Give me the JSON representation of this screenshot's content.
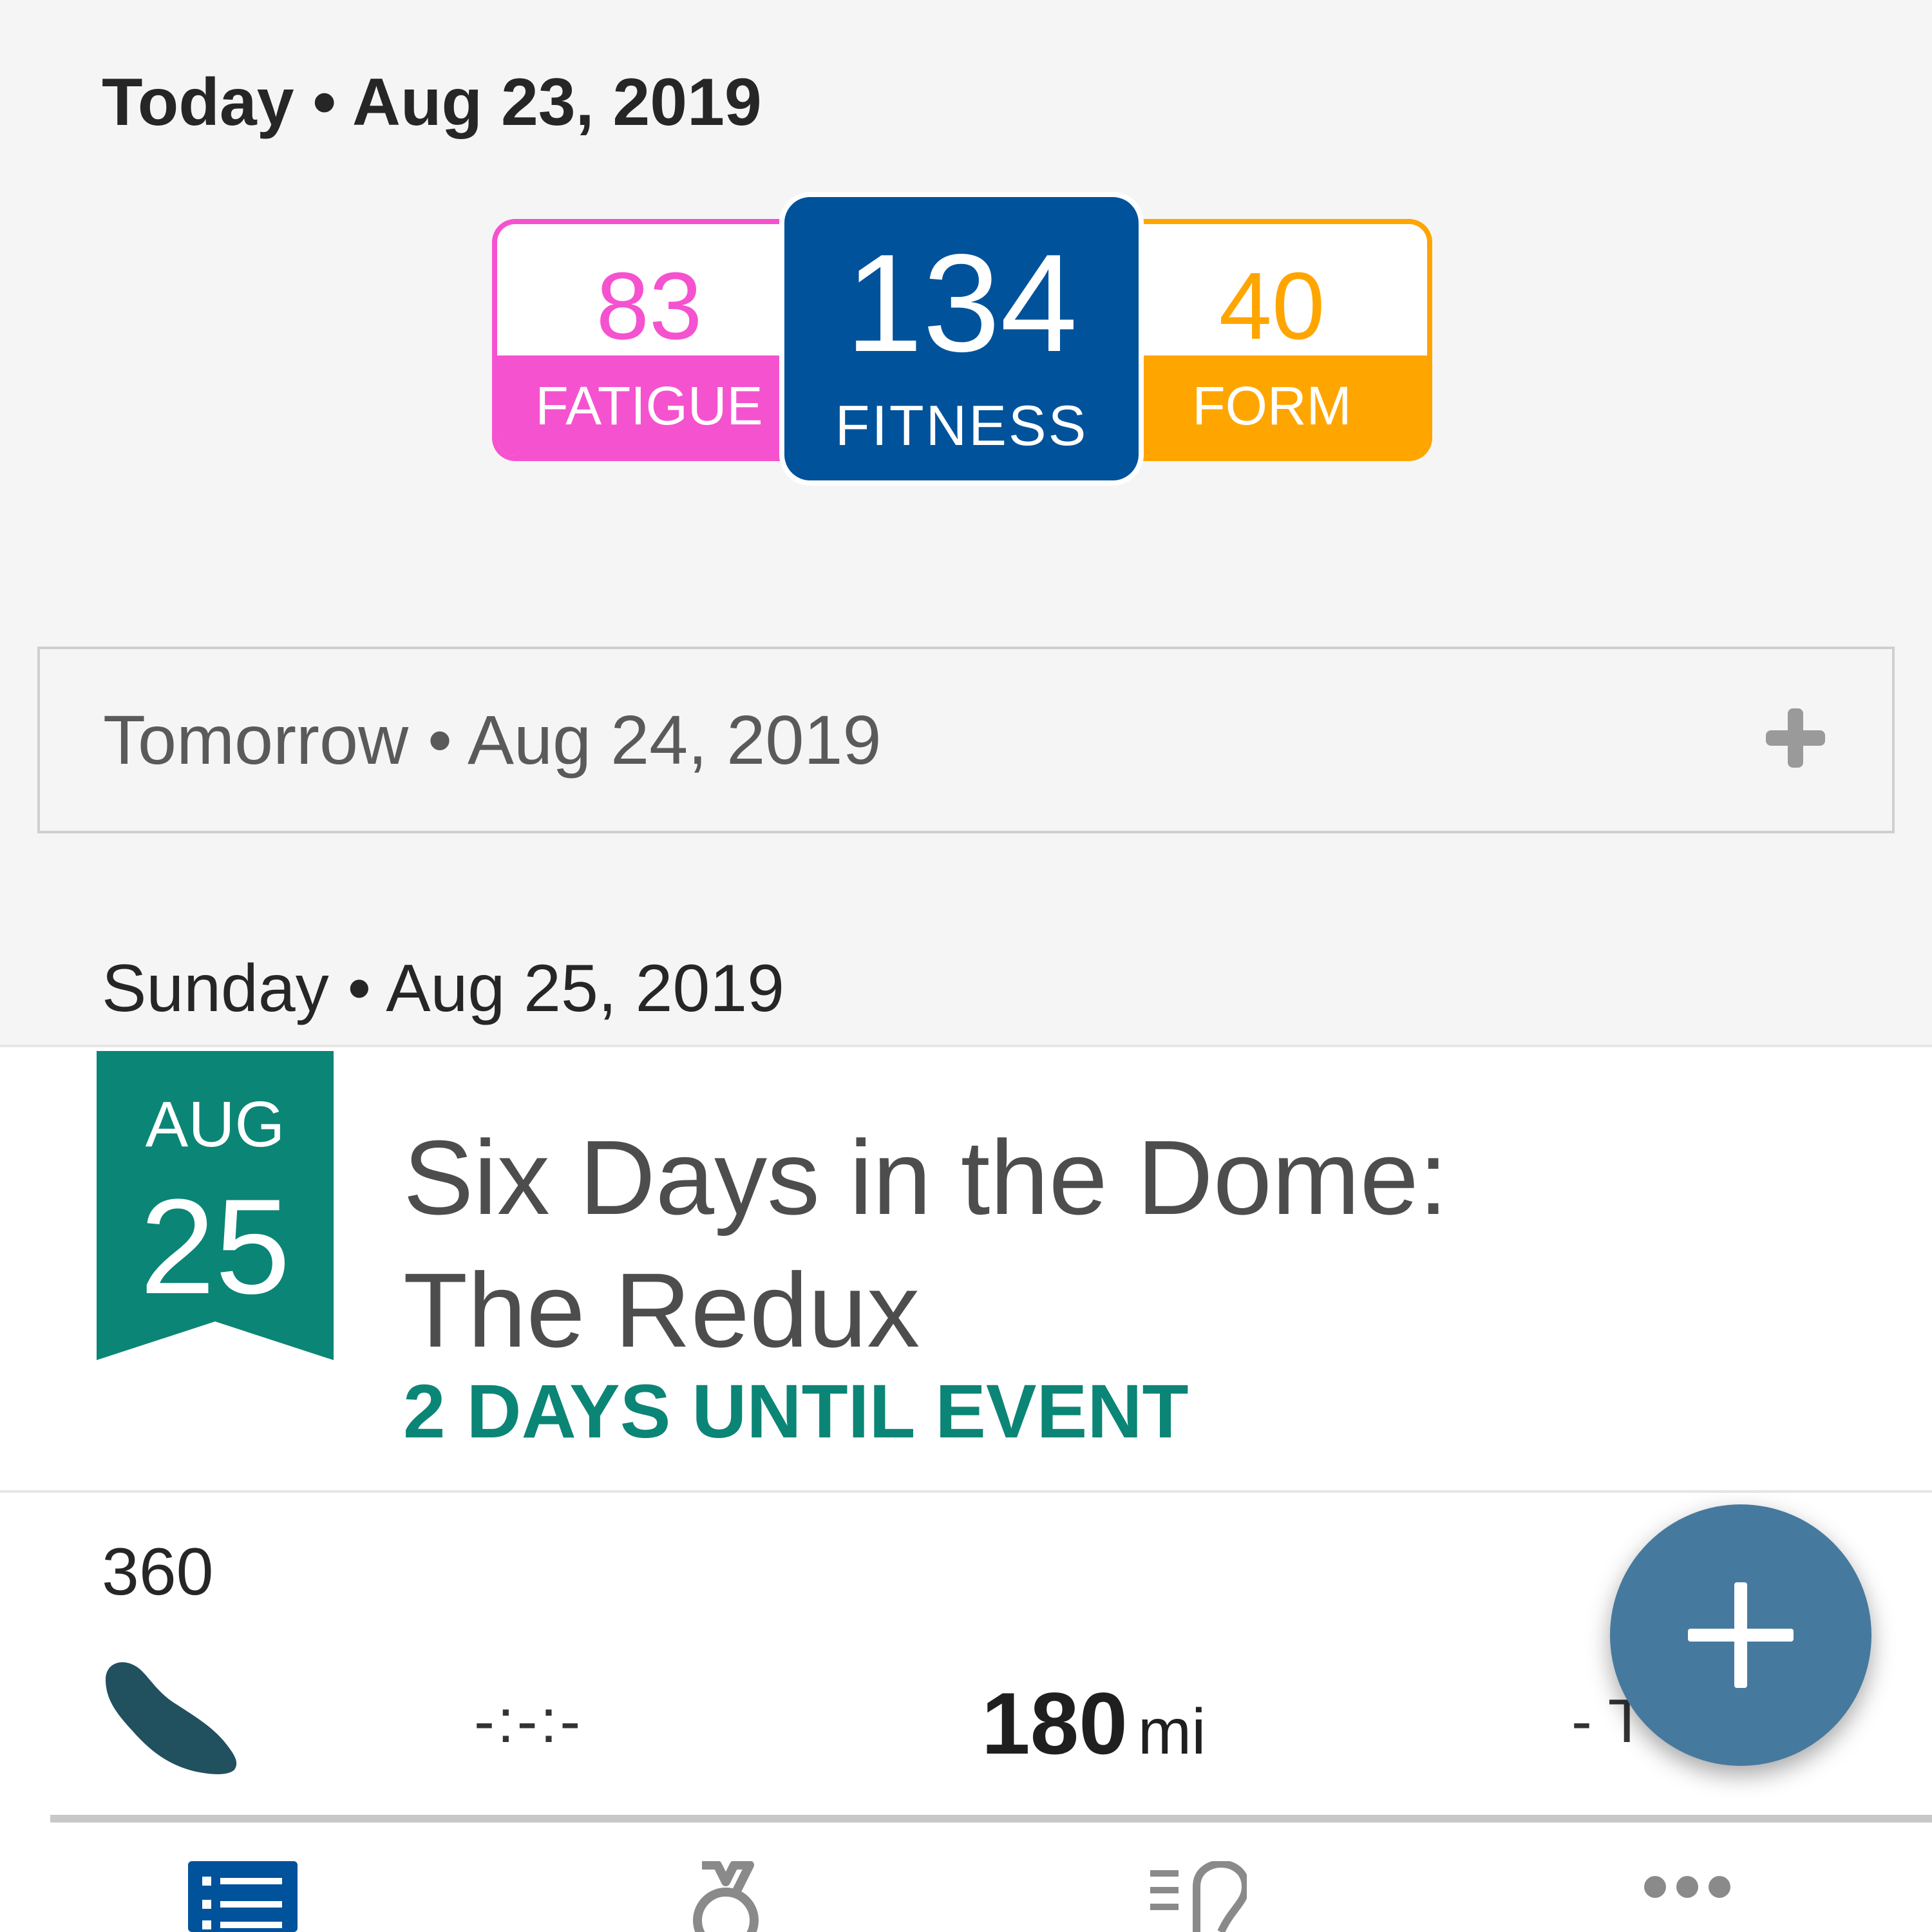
{
  "colors": {
    "fatigue": "#f552cf",
    "fitness": "#00529b",
    "form": "#ffa500",
    "event_accent": "#0b8576",
    "fab": "#46799e",
    "tab_active": "#00529b",
    "tab_inactive": "#8a8a8a"
  },
  "today": {
    "header": "Today • Aug 23, 2019",
    "metrics": {
      "fatigue": {
        "value": "83",
        "label": "FATIGUE"
      },
      "fitness": {
        "value": "134",
        "label": "FITNESS"
      },
      "form": {
        "value": "40",
        "label": "FORM"
      }
    }
  },
  "tomorrow": {
    "label": "Tomorrow • Aug 24, 2019",
    "add_icon": "plus-icon"
  },
  "sunday": {
    "header": "Sunday • Aug 25, 2019",
    "event": {
      "month": "AUG",
      "day": "25",
      "title_line1": "Six Days in the Dome:",
      "title_line2": "The Redux",
      "countdown": "2 DAYS UNTIL EVENT"
    },
    "workout": {
      "id": "360",
      "sport_icon": "running-shoe-icon",
      "duration": "-:-:-",
      "distance_value": "180",
      "distance_unit": "mi",
      "tss": "- T"
    }
  },
  "fab": {
    "icon": "plus-icon"
  },
  "tab_bar": {
    "tabs": [
      {
        "icon": "list-icon",
        "active": true
      },
      {
        "icon": "medal-icon",
        "active": false
      },
      {
        "icon": "dashboard-icon",
        "active": false
      },
      {
        "icon": "more-icon",
        "active": false
      }
    ]
  }
}
